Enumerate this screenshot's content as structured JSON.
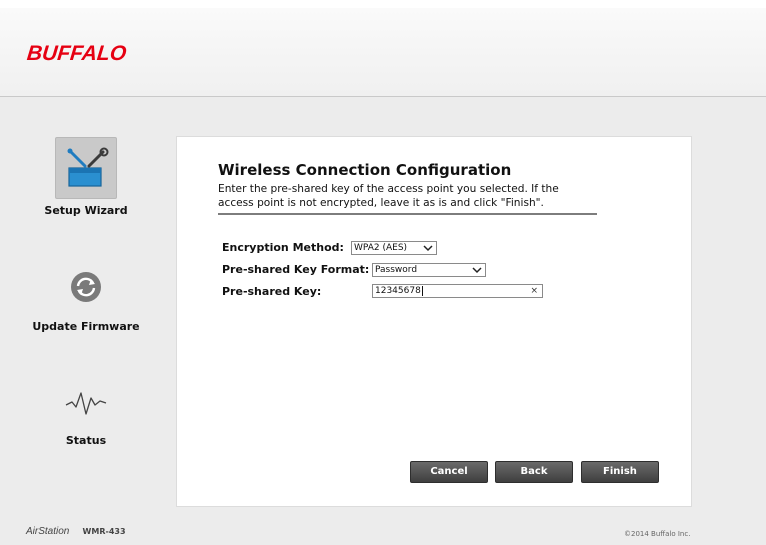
{
  "header": {
    "logo_text": "BUFFALO",
    "brand_color": "#e60012"
  },
  "sidebar": {
    "items": [
      {
        "label": "Setup Wizard",
        "icon": "toolbox-icon",
        "active": true
      },
      {
        "label": "Update Firmware",
        "icon": "refresh-icon",
        "active": false
      },
      {
        "label": "Status",
        "icon": "pulse-icon",
        "active": false
      }
    ]
  },
  "main": {
    "title": "Wireless Connection Configuration",
    "description": "Enter the pre-shared key of the access point you selected. If the access point is not encrypted, leave it as is and click \"Finish\".",
    "form": {
      "encryption_method": {
        "label": "Encryption Method:",
        "value": "WPA2 (AES)"
      },
      "key_format": {
        "label": "Pre-shared Key Format:",
        "value": "Password"
      },
      "key": {
        "label": "Pre-shared Key:",
        "value": "12345678",
        "clear_glyph": "×"
      }
    },
    "buttons": {
      "cancel": "Cancel",
      "back": "Back",
      "finish": "Finish"
    }
  },
  "footer": {
    "product": "AirStation",
    "model": "WMR-433",
    "copyright": "©2014 Buffalo Inc."
  }
}
